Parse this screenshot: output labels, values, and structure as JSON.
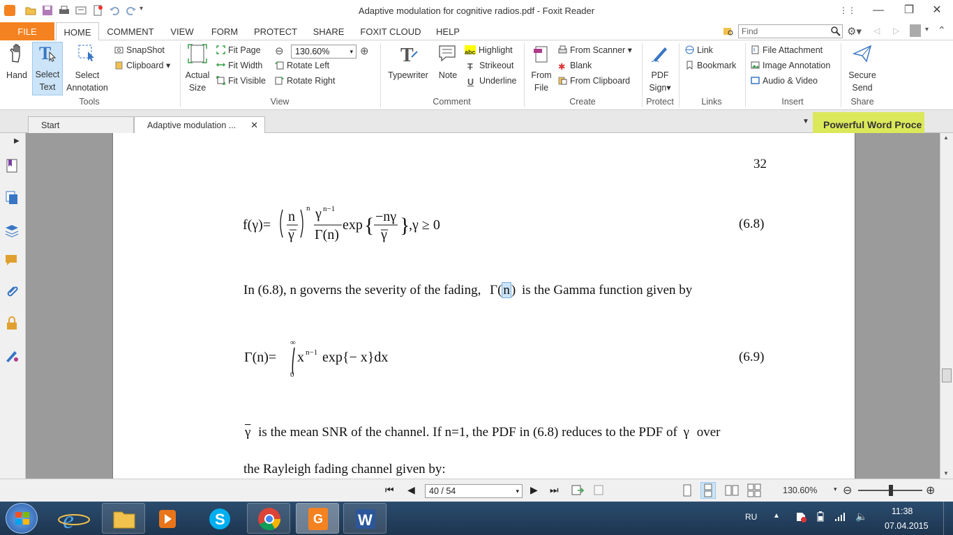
{
  "window": {
    "title": "Adaptive modulation for cognitive radios.pdf - Foxit Reader"
  },
  "menu": {
    "tabs": [
      "FILE",
      "HOME",
      "COMMENT",
      "VIEW",
      "FORM",
      "PROTECT",
      "SHARE",
      "FOXIT CLOUD",
      "HELP"
    ],
    "find_placeholder": "Find"
  },
  "ribbon": {
    "tools": {
      "hand": "Hand",
      "select_text_1": "Select",
      "select_text_2": "Text",
      "select_ann_1": "Select",
      "select_ann_2": "Annotation",
      "snapshot": "SnapShot",
      "clipboard": "Clipboard",
      "group": "Tools"
    },
    "view": {
      "actual_1": "Actual",
      "actual_2": "Size",
      "fit_page": "Fit Page",
      "fit_width": "Fit Width",
      "fit_visible": "Fit Visible",
      "zoom": "130.60%",
      "rotate_left": "Rotate Left",
      "rotate_right": "Rotate Right",
      "group": "View"
    },
    "comment": {
      "typewriter": "Typewriter",
      "note": "Note",
      "highlight": "Highlight",
      "strikeout": "Strikeout",
      "underline": "Underline",
      "group": "Comment"
    },
    "create": {
      "from_file_1": "From",
      "from_file_2": "File",
      "from_scanner": "From Scanner",
      "blank": "Blank",
      "from_clipboard": "From Clipboard",
      "group": "Create"
    },
    "protect": {
      "pdf_sign_1": "PDF",
      "pdf_sign_2": "Sign",
      "group": "Protect"
    },
    "links": {
      "link": "Link",
      "bookmark": "Bookmark",
      "group": "Links"
    },
    "insert": {
      "file_attachment": "File Attachment",
      "image_annotation": "Image Annotation",
      "audio_video": "Audio & Video",
      "group": "Insert"
    },
    "share": {
      "secure_1": "Secure",
      "secure_2": "Send",
      "group": "Share"
    }
  },
  "tabs": {
    "start": "Start",
    "doc": "Adaptive modulation ...",
    "ad": "Powerful Word Proce"
  },
  "document": {
    "page_number": "32",
    "eq1_number": "(6.8)",
    "eq2_number": "(6.9)",
    "para1_a": "In (6.8), n governs the severity of the fading,",
    "para1_gamma": "Γ(",
    "para1_n": "n",
    "para1_close": ")",
    "para1_b": "is the Gamma function given by",
    "para2_a": "is the mean SNR of the channel. If n=1, the PDF in (6.8) reduces to the PDF of",
    "para2_gamma": "γ",
    "para2_b": "over",
    "para3": "the Rayleigh fading channel given by:"
  },
  "bottom": {
    "page": "40 / 54",
    "zoom": "130.60%"
  },
  "tray": {
    "lang": "RU",
    "time": "11:38",
    "date": "07.04.2015"
  },
  "colors": {
    "accent": "#f58220",
    "ad": "#dbe85a",
    "selected": "#cce4f7"
  }
}
